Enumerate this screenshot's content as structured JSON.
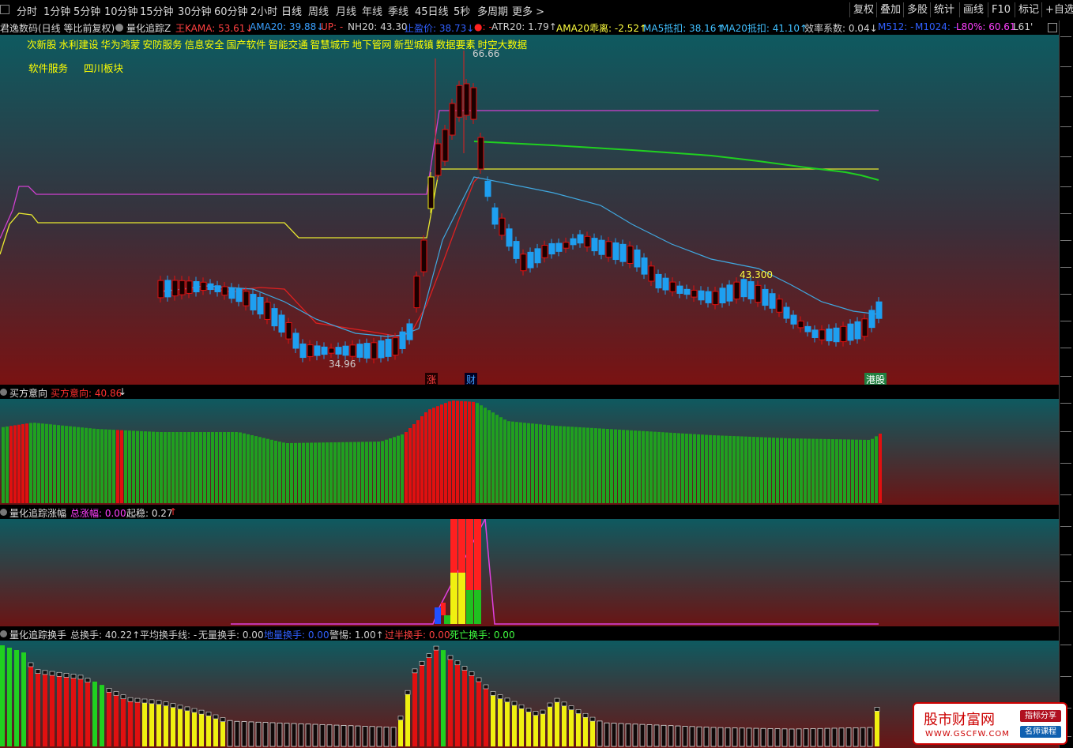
{
  "toolbar": {
    "periods": [
      "分时",
      "1分钟",
      "5分钟",
      "10分钟",
      "15分钟",
      "30分钟",
      "60分钟",
      "2小时",
      "日线",
      "周线",
      "月线",
      "年线",
      "季线",
      "45日线",
      "5秒",
      "多周期",
      "更多 >"
    ],
    "active_period": "日线",
    "right_buttons": [
      "复权",
      "叠加",
      "多股",
      "统计",
      "画线",
      "F10",
      "标记",
      "+自选"
    ]
  },
  "infobar": {
    "stock": "君逸数码(日线 等比前复权)",
    "indicator": "量化追踪Z",
    "items": [
      {
        "label": "王KAMA: 53.61",
        "arrow": "↓",
        "color": "#ff4040"
      },
      {
        "label": "AMA20: 39.88",
        "arrow": "↓",
        "color": "#3aa0ff"
      },
      {
        "label": "UP: -",
        "arrow": "",
        "color": "#ff4040"
      },
      {
        "label": "NH20: 43.30",
        "arrow": "",
        "color": "#d0d0d0"
      },
      {
        "label": "止盈价: 38.73",
        "arrow": "↓",
        "color": "#3060ff"
      },
      {
        "label": "●: -",
        "arrow": "",
        "color": "#ff2020"
      },
      {
        "label": "ATR20: 1.79",
        "arrow": "↑",
        "color": "#d0d0d0"
      },
      {
        "label": "AMA20乖离: -2.52",
        "arrow": "↑",
        "color": "#ffff40"
      },
      {
        "label": "MA5抵扣: 38.16",
        "arrow": "↑",
        "color": "#40c0ff"
      },
      {
        "label": "MA20抵扣: 41.10",
        "arrow": "↑",
        "color": "#40c0ff"
      },
      {
        "label": "效率系数: 0.04",
        "arrow": "↓",
        "color": "#d0d0d0"
      },
      {
        "label": "M512: -",
        "arrow": "",
        "color": "#3060ff"
      },
      {
        "label": "M1024: -",
        "arrow": "",
        "color": "#3060ff"
      },
      {
        "label": "L80%: 60.61",
        "arrow": "",
        "color": "#ff40ff"
      },
      {
        "label": "L61'",
        "arrow": "",
        "color": "#d0d0d0"
      }
    ]
  },
  "sectors": [
    "次新股",
    "水利建设",
    "华为鸿蒙",
    "安防服务",
    "信息安全",
    "国产软件",
    "智能交通",
    "智慧城市",
    "地下管网",
    "新型城镇",
    "数据要素",
    "时空大数据"
  ],
  "sectors2": [
    "软件服务",
    "四川板块"
  ],
  "annotations": {
    "high": "66.66",
    "low": "34.96",
    "nh": "43.300",
    "tag1": "涨",
    "tag2": "财",
    "tag3": "港股"
  },
  "panel2": {
    "title": "买方意向",
    "label": "买方意向: 40.86",
    "arrow": "↓"
  },
  "panel3": {
    "title": "量化追踪涨幅",
    "label1": "总涨幅: 0.00",
    "label2": "起稳: 0.27",
    "arrow": "↑"
  },
  "panel4": {
    "title": "量化追踪换手",
    "items": [
      {
        "label": "总换手: 40.22",
        "arrow": "↑",
        "color": "#d0d0d0"
      },
      {
        "label": "平均换手线: -",
        "arrow": "",
        "color": "#d0d0d0"
      },
      {
        "label": "无量换手: 0.00",
        "arrow": "",
        "color": "#d0d0d0"
      },
      {
        "label": "地量换手: 0.00",
        "arrow": "",
        "color": "#3060ff"
      },
      {
        "label": "警惕: 1.00",
        "arrow": "↑",
        "color": "#d0d0d0"
      },
      {
        "label": "过半换手: 0.00",
        "arrow": "",
        "color": "#ff4040"
      },
      {
        "label": "死亡换手: 0.00",
        "arrow": "",
        "color": "#40ff40"
      }
    ]
  },
  "watermark": {
    "title": "股市财富网",
    "url": "WWW.GSCFW.COM",
    "badge1": "指标分享",
    "badge2": "名师课程"
  },
  "colors": {
    "up": "#e01010",
    "down": "#1e9ff0",
    "magenta": "#d040d0",
    "yellow": "#e8e830",
    "green": "#20d020",
    "lightblue": "#40a8e0"
  }
}
